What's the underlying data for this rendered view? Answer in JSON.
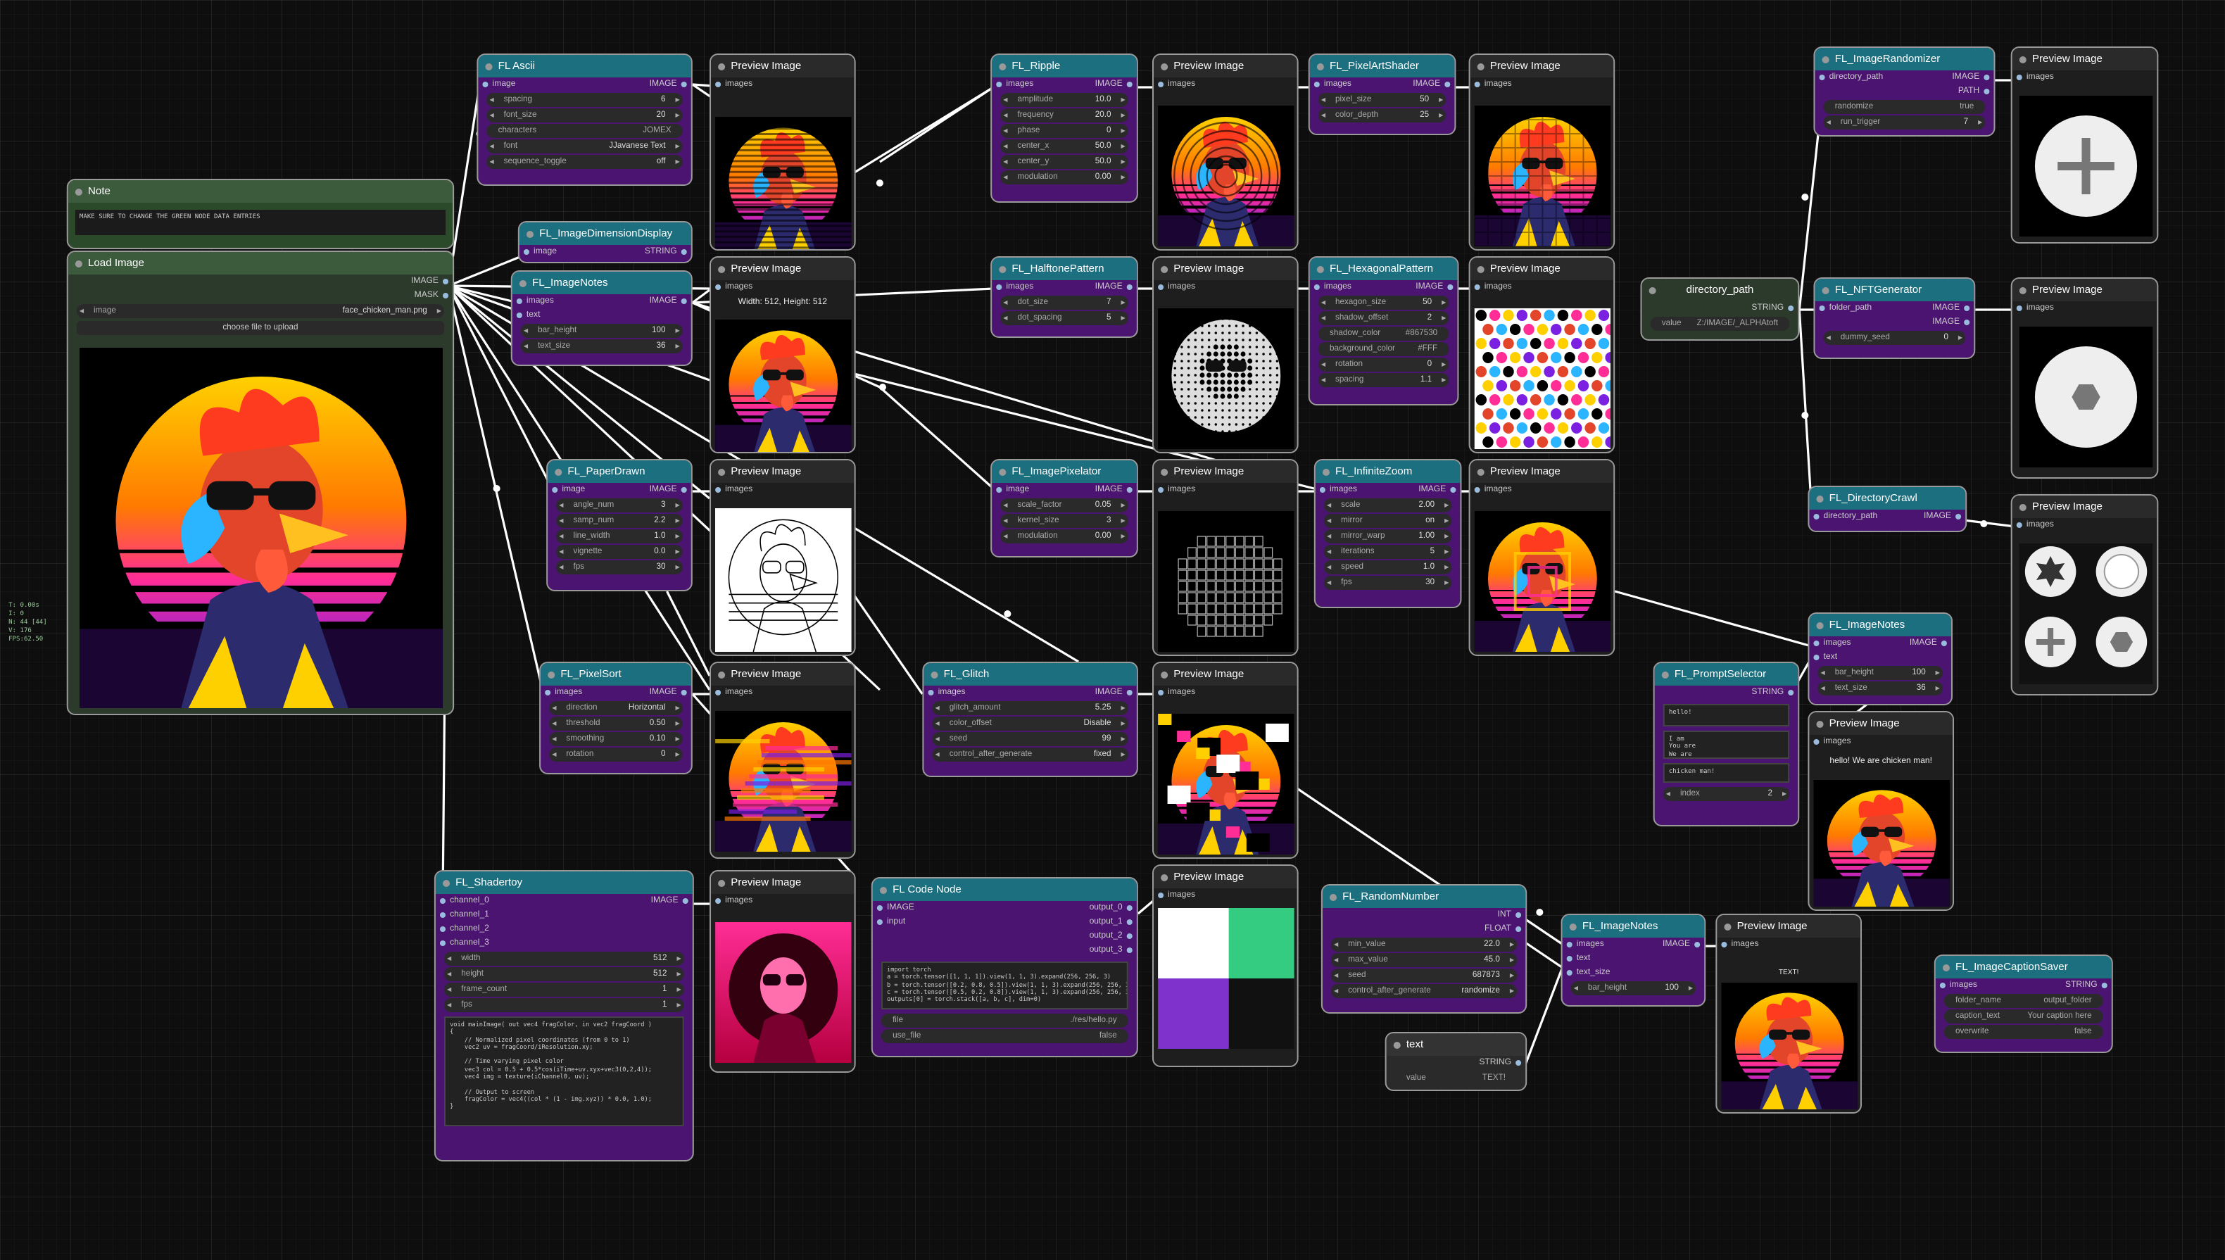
{
  "stats": [
    "T: 0.00s",
    "I: 0",
    "N: 44 [44]",
    "V: 176",
    "FPS:62.50"
  ],
  "note": {
    "title": "Note",
    "text": "MAKE SURE TO CHANGE THE GREEN NODE DATA ENTRIES"
  },
  "load_image": {
    "title": "Load Image",
    "outputs": [
      "IMAGE",
      "MASK"
    ],
    "image_label": "image",
    "image_value": "face_chicken_man.png",
    "upload": "choose file to upload"
  },
  "ascii": {
    "title": "FL Ascii",
    "input": "image",
    "output": "IMAGE",
    "widgets": [
      [
        "spacing",
        "6"
      ],
      [
        "font_size",
        "20"
      ]
    ],
    "characters": "characters",
    "char_val": "JOMEX",
    "font": "font",
    "font_val": "JJavanese Text",
    "seq": "sequence_toggle",
    "seq_val": "off"
  },
  "dimdisp": {
    "title": "FL_ImageDimensionDisplay",
    "input": "image",
    "output": "STRING"
  },
  "imgnotes1": {
    "title": "FL_ImageNotes",
    "inputs": [
      "images",
      "text"
    ],
    "output": "IMAGE",
    "widgets": [
      [
        "bar_height",
        "100"
      ],
      [
        "text_size",
        "36"
      ]
    ]
  },
  "paperdrawn": {
    "title": "FL_PaperDrawn",
    "input": "image",
    "output": "IMAGE",
    "widgets": [
      [
        "angle_num",
        "3"
      ],
      [
        "samp_num",
        "2.2"
      ],
      [
        "line_width",
        "1.0"
      ],
      [
        "vignette",
        "0.0"
      ],
      [
        "fps",
        "30"
      ]
    ]
  },
  "pixelsort": {
    "title": "FL_PixelSort",
    "input": "images",
    "output": "IMAGE",
    "widgets": [
      [
        "direction",
        "Horizontal"
      ],
      [
        "threshold",
        "0.50"
      ],
      [
        "smoothing",
        "0.10"
      ],
      [
        "rotation",
        "0"
      ]
    ]
  },
  "shadertoy": {
    "title": "FL_Shadertoy",
    "inputs": [
      "channel_0",
      "channel_1",
      "channel_2",
      "channel_3"
    ],
    "output": "IMAGE",
    "widgets": [
      [
        "width",
        "512"
      ],
      [
        "height",
        "512"
      ],
      [
        "frame_count",
        "1"
      ],
      [
        "fps",
        "1"
      ]
    ],
    "code": "void mainImage( out vec4 fragColor, in vec2 fragCoord )\n{\n    // Normalized pixel coordinates (from 0 to 1)\n    vec2 uv = fragCoord/iResolution.xy;\n\n    // Time varying pixel color\n    vec3 col = 0.5 + 0.5*cos(iTime+uv.xyx+vec3(0,2,4));\n    vec4 img = texture(iChannel0, uv);\n\n    // Output to screen\n    fragColor = vec4((col * (1 - img.xyz)) * 0.0, 1.0);\n}"
  },
  "preview": {
    "title": "Preview Image",
    "input": "images",
    "dims": "Width: 512, Height: 512"
  },
  "ripple": {
    "title": "FL_Ripple",
    "input": "images",
    "output": "IMAGE",
    "widgets": [
      [
        "amplitude",
        "10.0"
      ],
      [
        "frequency",
        "20.0"
      ],
      [
        "phase",
        "0"
      ],
      [
        "center_x",
        "50.0"
      ],
      [
        "center_y",
        "50.0"
      ],
      [
        "modulation",
        "0.00"
      ]
    ]
  },
  "halftone": {
    "title": "FL_HalftonePattern",
    "input": "images",
    "output": "IMAGE",
    "widgets": [
      [
        "dot_size",
        "7"
      ],
      [
        "dot_spacing",
        "5"
      ]
    ]
  },
  "pixelator": {
    "title": "FL_ImagePixelator",
    "input": "image",
    "output": "IMAGE",
    "widgets": [
      [
        "scale_factor",
        "0.05"
      ],
      [
        "kernel_size",
        "3"
      ],
      [
        "modulation",
        "0.00"
      ]
    ]
  },
  "glitch": {
    "title": "FL_Glitch",
    "input": "images",
    "output": "IMAGE",
    "widgets": [
      [
        "glitch_amount",
        "5.25"
      ],
      [
        "color_offset",
        "Disable"
      ],
      [
        "seed",
        "99"
      ],
      [
        "control_after_generate",
        "fixed"
      ]
    ]
  },
  "codenode": {
    "title": "FL Code Node",
    "inputs": [
      "IMAGE",
      "input"
    ],
    "outputs": [
      "output_0",
      "output_1",
      "output_2",
      "output_3"
    ],
    "code": "import torch\na = torch.tensor([1, 1, 1]).view(1, 1, 3).expand(256, 256, 3)\nb = torch.tensor([0.2, 0.8, 0.5]).view(1, 1, 3).expand(256, 256, 3)\nc = torch.tensor([0.5, 0.2, 0.8]).view(1, 1, 3).expand(256, 256, 3)\noutputs[0] = torch.stack([a, b, c], dim=0)",
    "file": "file",
    "file_val": "./res/hello.py",
    "use_file": "use_file",
    "use_file_val": "false"
  },
  "pixelart": {
    "title": "FL_PixelArtShader",
    "input": "images",
    "output": "IMAGE",
    "widgets": [
      [
        "pixel_size",
        "50"
      ],
      [
        "color_depth",
        "25"
      ]
    ]
  },
  "hexagonal": {
    "title": "FL_HexagonalPattern",
    "input": "images",
    "output": "IMAGE",
    "widgets": [
      [
        "hexagon_size",
        "50"
      ],
      [
        "shadow_offset",
        "2"
      ]
    ],
    "texts": [
      [
        "shadow_color",
        "#867530"
      ],
      [
        "background_color",
        "#FFF"
      ]
    ],
    "widgets2": [
      [
        "rotation",
        "0"
      ],
      [
        "spacing",
        "1.1"
      ]
    ]
  },
  "infinitezoom": {
    "title": "FL_InfiniteZoom",
    "input": "images",
    "output": "IMAGE",
    "widgets": [
      [
        "scale",
        "2.00"
      ],
      [
        "mirror",
        "on"
      ],
      [
        "mirror_warp",
        "1.00"
      ],
      [
        "iterations",
        "5"
      ],
      [
        "speed",
        "1.0"
      ],
      [
        "fps",
        "30"
      ]
    ]
  },
  "randomnumber": {
    "title": "FL_RandomNumber",
    "outputs": [
      "INT",
      "FLOAT"
    ],
    "widgets": [
      [
        "min_value",
        "22.0"
      ],
      [
        "max_value",
        "45.0"
      ],
      [
        "seed",
        "687873"
      ],
      [
        "control_after_generate",
        "randomize"
      ]
    ]
  },
  "textnode": {
    "title": "text",
    "output": "STRING",
    "value_label": "value",
    "value": "TEXT!"
  },
  "imgnotes3": {
    "title": "FL_ImageNotes",
    "inputs": [
      "images",
      "text",
      "text_size"
    ],
    "output": "IMAGE",
    "widgets": [
      [
        "bar_height",
        "100"
      ]
    ]
  },
  "preview_text": "TEXT!",
  "dirpath": {
    "title": "directory_path",
    "output": "STRING",
    "value_label": "value",
    "value": "Z:/IMAGE/_ALPHAtoft"
  },
  "randomizer": {
    "title": "FL_ImageRandomizer",
    "input": "directory_path",
    "outputs": [
      "IMAGE",
      "PATH"
    ],
    "toggle": "randomize",
    "toggle_val": "true",
    "widgets": [
      [
        "run_trigger",
        "7"
      ]
    ]
  },
  "nftgen": {
    "title": "FL_NFTGenerator",
    "input": "folder_path",
    "outputs": [
      "IMAGE",
      "IMAGE"
    ],
    "widgets": [
      [
        "dummy_seed",
        "0"
      ]
    ]
  },
  "dircrawl": {
    "title": "FL_DirectoryCrawl",
    "input": "directory_path",
    "output": "IMAGE"
  },
  "imgnotes2": {
    "title": "FL_ImageNotes",
    "inputs": [
      "images",
      "text"
    ],
    "output": "IMAGE",
    "widgets": [
      [
        "bar_height",
        "100"
      ],
      [
        "text_size",
        "36"
      ]
    ]
  },
  "prompt": {
    "title": "FL_PromptSelector",
    "output": "STRING",
    "text1": "hello!",
    "text2": "I am\nYou are\nWe are",
    "text3": "chicken man!",
    "index_label": "index",
    "index_val": "2"
  },
  "preview_hello": "hello! We are chicken man!",
  "caption": {
    "title": "FL_ImageCaptionSaver",
    "input": "images",
    "output": "STRING",
    "texts": [
      [
        "folder_name",
        "output_folder"
      ],
      [
        "caption_text",
        "Your caption here"
      ]
    ],
    "toggle": "overwrite",
    "toggle_val": "false"
  },
  "colors": {
    "node_header": "#1c6f7f",
    "node_body": "#4a1470",
    "link": "#ffffff",
    "grid_bg": "#0e0e0e"
  }
}
